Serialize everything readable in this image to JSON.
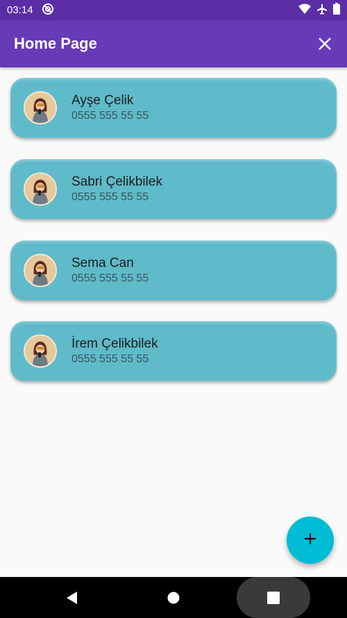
{
  "status_bar": {
    "time": "03:14",
    "icons": [
      "do-not-disturb-icon",
      "wifi-icon",
      "airplane-icon",
      "battery-icon"
    ]
  },
  "app_bar": {
    "title": "Home Page",
    "close_icon": "close-icon"
  },
  "contacts": [
    {
      "name": "Ayşe Çelik",
      "phone": "0555 555 55 55"
    },
    {
      "name": "Sabri Çelikbilek",
      "phone": "0555 555 55 55"
    },
    {
      "name": "Sema Can",
      "phone": "0555 555 55 55"
    },
    {
      "name": "İrem Çelikbilek",
      "phone": "0555 555 55 55"
    }
  ],
  "fab": {
    "icon": "plus-icon"
  },
  "nav_bar": {
    "icons": [
      "back-icon",
      "home-icon",
      "recents-icon"
    ]
  },
  "colors": {
    "app_bar": "#673ab7",
    "status_bar": "#5b2ea6",
    "card": "#5fbac9",
    "fab": "#00bcd4"
  }
}
